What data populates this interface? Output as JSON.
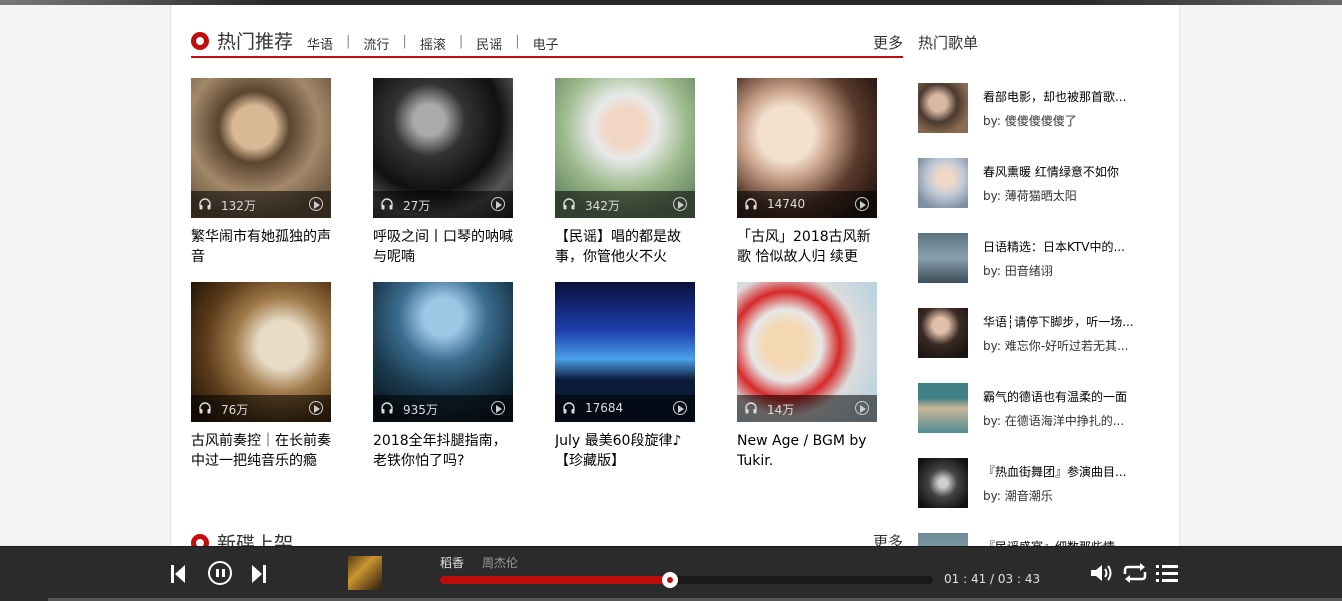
{
  "hot": {
    "title": "热门推荐",
    "tabs": [
      "华语",
      "流行",
      "摇滚",
      "民谣",
      "电子"
    ],
    "more": "更多",
    "playlists": [
      {
        "count": "132万",
        "name": "繁华闹市有她孤独的声音"
      },
      {
        "count": "27万",
        "name": "呼吸之间丨口琴的呐喊与呢喃"
      },
      {
        "count": "342万",
        "name": "【民谣】唱的都是故事，你管他火不火"
      },
      {
        "count": "14740",
        "name": "「古风」2018古风新歌 恰似故人归 续更"
      },
      {
        "count": "76万",
        "name": "古风前奏控｜在长前奏中过一把纯音乐的瘾"
      },
      {
        "count": "935万",
        "name": "2018全年抖腿指南，老铁你怕了吗?"
      },
      {
        "count": "17684",
        "name": "July 最美60段旋律♪【珍藏版】"
      },
      {
        "count": "14万",
        "name": "New Age / BGM by Tukir."
      }
    ]
  },
  "side": {
    "title": "热门歌单",
    "items": [
      {
        "title": "看部电影，却也被那首歌...",
        "by": "by: 傻傻傻傻傻了"
      },
      {
        "title": "春风熏暖 红情绿意不如你",
        "by": "by: 薄荷猫晒太阳"
      },
      {
        "title": "日语精选：日本KTV中的...",
        "by": "by: 田音绪诩"
      },
      {
        "title": "华语┆请停下脚步，听一场...",
        "by": "by: 难忘你-好听过若无其..."
      },
      {
        "title": "霸气的德语也有温柔的一面",
        "by": "by: 在德语海洋中挣扎的..."
      },
      {
        "title": "『热血街舞团』参演曲目...",
        "by": "by: 潮音潮乐"
      },
      {
        "title": "『民谣盛宴』细数那些情...",
        "by": ""
      }
    ]
  },
  "new_albums": {
    "title": "新碟上架",
    "more": "更多"
  },
  "player": {
    "song": "稻香",
    "artist": "周杰伦",
    "time": "01 : 41 / 03 : 43",
    "progress": 0.466
  },
  "colors": {
    "accent": "#c20c0c",
    "player_bg": "#2b2b2b"
  }
}
